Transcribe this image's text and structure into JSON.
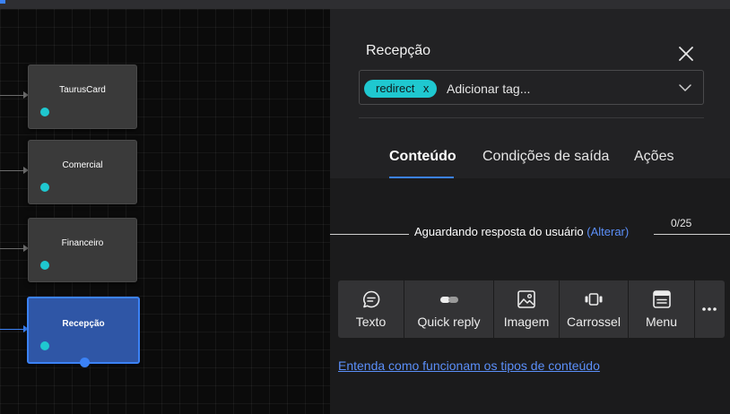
{
  "flow": {
    "nodes": [
      {
        "label": "TaurusCard",
        "selected": false
      },
      {
        "label": "Comercial",
        "selected": false
      },
      {
        "label": "Financeiro",
        "selected": false
      },
      {
        "label": "Recepção",
        "selected": true
      }
    ]
  },
  "panel": {
    "title": "Recepção",
    "tags": {
      "chips": [
        {
          "label": "redirect",
          "remove": "x"
        }
      ],
      "placeholder": "Adicionar tag..."
    },
    "tabs": [
      {
        "label": "Conteúdo",
        "active": true
      },
      {
        "label": "Condições de saída",
        "active": false
      },
      {
        "label": "Ações",
        "active": false
      }
    ],
    "status": {
      "text": "Aguardando resposta do usuário",
      "link": "(Alterar)"
    },
    "counter": "0/25",
    "content_types": [
      {
        "label": "Texto",
        "icon": "chat-bubble-icon"
      },
      {
        "label": "Quick reply",
        "icon": "toggle-pills-icon"
      },
      {
        "label": "Imagem",
        "icon": "image-icon"
      },
      {
        "label": "Carrossel",
        "icon": "carousel-icon"
      },
      {
        "label": "Menu",
        "icon": "menu-card-icon"
      }
    ],
    "more_icon": "more-horizontal-icon",
    "help_link": "Entenda como funcionam os tipos de conteúdo"
  },
  "colors": {
    "accent": "#3b82f6",
    "port": "#1fc8d0",
    "chip": "#1fc8d0",
    "link": "#5b8ff9"
  }
}
